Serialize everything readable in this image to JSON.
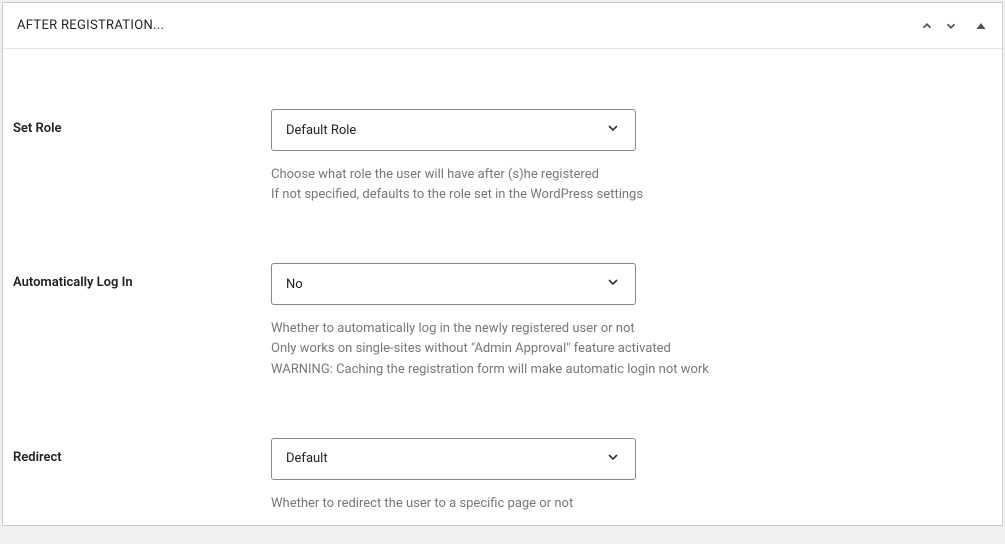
{
  "panel": {
    "title": "AFTER REGISTRATION..."
  },
  "fields": {
    "setRole": {
      "label": "Set Role",
      "selected": "Default Role",
      "help1": "Choose what role the user will have after (s)he registered",
      "help2": "If not specified, defaults to the role set in the WordPress settings"
    },
    "autoLogin": {
      "label": "Automatically Log In",
      "selected": "No",
      "help1": "Whether to automatically log in the newly registered user or not",
      "help2": "Only works on single-sites without \"Admin Approval\" feature activated",
      "help3": "WARNING: Caching the registration form will make automatic login not work"
    },
    "redirect": {
      "label": "Redirect",
      "selected": "Default",
      "help1": "Whether to redirect the user to a specific page or not"
    }
  }
}
